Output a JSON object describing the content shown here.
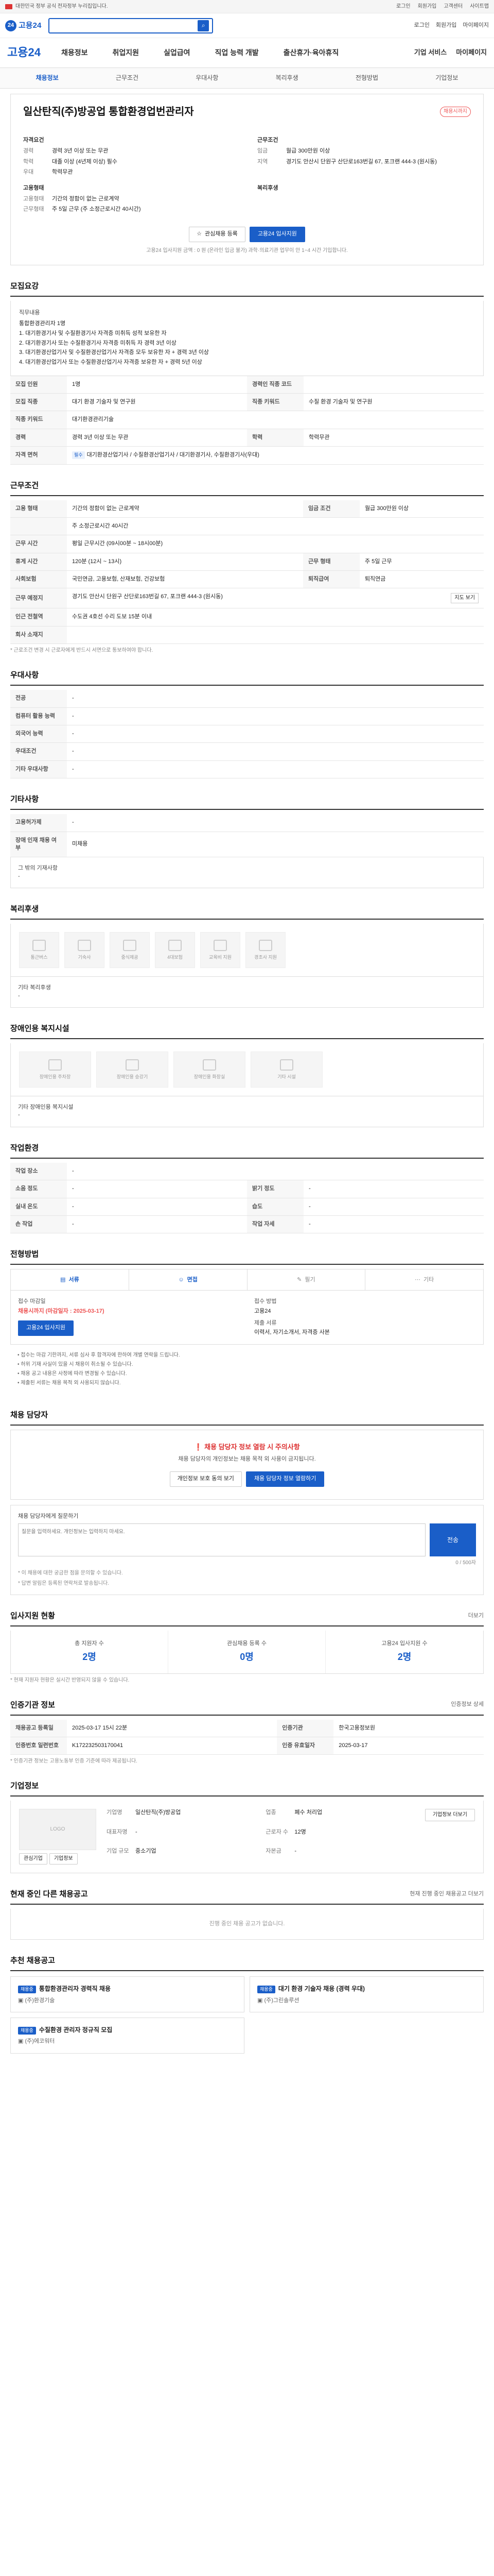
{
  "topbar": {
    "site_name": "대한민국 정부 공식 전자정부 누리집입니다.",
    "links": [
      "로그인",
      "회원가입",
      "고객센터",
      "사이트맵"
    ]
  },
  "header": {
    "logo": "고용24",
    "search_placeholder": "",
    "links": [
      "로그인",
      "회원가입",
      "마이페이지"
    ]
  },
  "nav": {
    "brand": "고용24",
    "items": [
      "채용정보",
      "취업지원",
      "실업급여",
      "직업 능력 개발",
      "출산휴가·육아휴직"
    ],
    "right": [
      "기업 서비스",
      "마이페이지"
    ]
  },
  "subnav": {
    "items": [
      "채용정보",
      "근무조건",
      "우대사항",
      "복리후생",
      "전형방법",
      "기업정보"
    ],
    "active": 0
  },
  "job": {
    "title": "일산탄직(주)방공업 통합환경업번관리자",
    "badge": "채용시까지",
    "info_left_title": "자격요건",
    "info_left": [
      {
        "k": "경력",
        "v": "경력 3년 이상 또는 무관"
      },
      {
        "k": "학력",
        "v": "대졸 이상 (4년제 이상) 필수"
      },
      {
        "k": "우대",
        "v": "학력무관"
      }
    ],
    "info_right_title": "근무조건",
    "info_right": [
      {
        "k": "임금",
        "v": "월급 300만원 이상"
      },
      {
        "k": "지역",
        "v": "경기도 안산시 단원구 산단로163번길 67, 포크랜 444-3 (원시동)"
      }
    ],
    "info_left2_title": "고용형태",
    "info_left2": [
      {
        "k": "고용형태",
        "v": "기간의 정함이 없는 근로계약"
      },
      {
        "k": "근무형태",
        "v": "주 5일 근무 (주 소정근로시간 40시간)"
      }
    ],
    "info_right2_title": "복리후생",
    "btn_interest": "관심채용 등록",
    "btn_apply": "고용24 입사지원",
    "note": "고용24 입사지원 금액 : 0 원 (온라인 입금 불가) 과학·의료기관 업무이 안 1~4 시간 기입합니다."
  },
  "recruit": {
    "title": "모집요강",
    "work_label": "직무내용",
    "work_sub": "통합환경관리자 1명",
    "work_lines": [
      "1. 대기환경기사 및 수질환경기사 자격증 미취득 성적 보유한 자",
      "2. 대기환경기사 또는 수질환경기사 자격증 미취득 자 경력 3년 이상",
      "3. 대기환경산업기사 및 수질환경산업기사 자격증 모두 보유한 자 + 경력 3년 이상",
      "4. 대기환경산업기사 또는 수질환경산업기사 자격증 보유한 자 + 경력 5년 이상"
    ],
    "rows": [
      {
        "k": "모집 인원",
        "v": "1명",
        "k2": "경력인 직종 코드",
        "v2": ""
      },
      {
        "k": "모집 직종",
        "v": "대기 환경 기술자 및 연구원",
        "k2": "직종 키워드",
        "v2": "수질 환경 기술자 및 연구원"
      },
      {
        "k": "직종 키워드",
        "v": "대기환경관리기술",
        "k2": "",
        "v2": ""
      },
      {
        "k": "경력",
        "v": "경력 3년 이상 또는 무관",
        "k2": "학력",
        "v2": "학력무관"
      },
      {
        "k": "자격 면허",
        "v": "대기환경산업기사 / 수질환경산업기사 / 대기환경기사, 수질환경기사(우대)",
        "k2": "",
        "v2": ""
      }
    ]
  },
  "conditions": {
    "title": "근무조건",
    "rows": [
      {
        "k": "고용 형태",
        "v": "기간의 정함이 없는 근로계약",
        "k2": "임금 조건",
        "v2": "월급 300만원 이상"
      },
      {
        "k": "",
        "v": "주 소정근로시간 40시간",
        "k2": "",
        "v2": ""
      },
      {
        "k": "근무 시간",
        "v": "평일 근무시간 (09시00분 ~ 18시00분)",
        "k2": "",
        "v2": ""
      },
      {
        "k": "휴게 시간",
        "v": "120분 (12시 ~ 13시)",
        "k2": "근무 형태",
        "v2": "주 5일 근무"
      },
      {
        "k": "사회보험",
        "v": "국민연금, 고용보험, 산재보험, 건강보험",
        "k2": "퇴직급여",
        "v2": "퇴직연금"
      },
      {
        "k": "근무 예정지",
        "v": "경기도 안산시 단원구 산단로163번길 67, 포크랜 444-3 (원시동)",
        "k2": "",
        "v2": ""
      },
      {
        "k": "인근 전철역",
        "v": "수도권 4호선 수리 도보 15분 이내",
        "k2": "",
        "v2": ""
      },
      {
        "k": "회사 소재지",
        "v": "",
        "k2": "",
        "v2": ""
      }
    ],
    "map_btn": "지도 보기",
    "note": "* 근로조건 변경 시 근로자에게 반드시 서면으로 통보하여야 합니다."
  },
  "preference": {
    "title": "우대사항",
    "rows": [
      {
        "k": "전공",
        "v": "-"
      },
      {
        "k": "컴퓨터 활용 능력",
        "v": "-"
      },
      {
        "k": "외국어 능력",
        "v": "-"
      },
      {
        "k": "우대조건",
        "v": "-"
      },
      {
        "k": "기타 우대사항",
        "v": "-"
      }
    ]
  },
  "other": {
    "title": "기타사항",
    "rows": [
      {
        "k": "고용허가제",
        "v": "-"
      },
      {
        "k": "장애 인재 채용 여부",
        "v": "미채용"
      }
    ],
    "extra_label": "그 밖의 기재사항",
    "extra_value": "-"
  },
  "welfare": {
    "title": "복리후생",
    "icons": [
      "통근버스",
      "기숙사",
      "중식제공",
      "4대보험",
      "교육비 지원",
      "경조사 지원"
    ],
    "sub_label": "기타 복리후생",
    "sub_value": "-"
  },
  "disability": {
    "title": "장애인용 복지시설",
    "icons": [
      "장애인용 주차장",
      "장애인용 승강기",
      "장애인용 화장실",
      "기타 시설"
    ],
    "sub_label": "기타 장애인용 복지시설",
    "sub_value": "-"
  },
  "workenv": {
    "title": "작업환경",
    "rows": [
      {
        "k": "작업 장소",
        "v": "-",
        "k2": "",
        "v2": ""
      },
      {
        "k": "소음 정도",
        "v": "-",
        "k2": "밝기 정도",
        "v2": "-"
      },
      {
        "k": "실내 온도",
        "v": "-",
        "k2": "습도",
        "v2": "-"
      },
      {
        "k": "손 작업",
        "v": "-",
        "k2": "작업 자세",
        "v2": "-"
      }
    ]
  },
  "process": {
    "title": "전형방법",
    "steps": [
      "서류",
      "면접",
      "필기",
      "기타"
    ],
    "deadline_label": "접수 마감일",
    "deadline_value": "채용시까지 (마감일자 : 2025-03-17)",
    "method_label": "접수 방법",
    "method_value": "고용24",
    "doc_label": "제출 서류",
    "doc_value": "이력서, 자기소개서, 자격증 사본",
    "apply_btn": "고용24 입사지원",
    "bullets": [
      "• 접수는 마감 기한까지, 서류 심사 후 합격자에 한하여 개별 연락을 드립니다.",
      "• 허위 기재 사실이 있을 시 채용이 취소될 수 있습니다.",
      "• 채용 공고 내용은 사정에 따라 변경될 수 있습니다.",
      "• 제출된 서류는 채용 목적 외 사용되지 않습니다."
    ]
  },
  "contact": {
    "title": "채용 담당자",
    "warn_title": "채용 담당자 정보 열람 시 주의사항",
    "warn_desc": "채용 담당자의 개인정보는 채용 목적 외 사용이 금지됩니다.",
    "btn_left": "개인정보 보호 동의 보기",
    "btn_right": "채용 담당자 정보 열람하기",
    "qna_title": "채용 담당자에게 질문하기",
    "qna_placeholder": "질문을 입력하세요. 개인정보는 입력하지 마세요.",
    "qna_count": "0 / 500자",
    "qna_send": "전송",
    "notes": [
      "* 이 채용에 대한 궁금한 점을 문의할 수 있습니다.",
      "* 답변 알림은 등록된 연락처로 발송됩니다."
    ]
  },
  "stats": {
    "title": "입사지원 현황",
    "more": "더보기",
    "cells": [
      {
        "label": "총 지원자 수",
        "value": "2명"
      },
      {
        "label": "관심채용 등록 수",
        "value": "0명"
      },
      {
        "label": "고용24 입사지원 수",
        "value": "2명"
      }
    ],
    "note": "* 현재 지원자 현황은 실시간 반영되지 않을 수 있습니다."
  },
  "certinfo": {
    "title": "인증기관 정보",
    "more_btn": "인증정보 상세",
    "rows": [
      {
        "k": "채용공고 등록일",
        "v": "2025-03-17 15시 22분",
        "k2": "인증기관",
        "v2": "한국고용정보원"
      },
      {
        "k": "인증번호 일련번호",
        "v": "K172232503170041",
        "k2": "인증 유효일자",
        "v2": "2025-03-17"
      }
    ],
    "note": "* 인증기관 정보는 고용노동부 인증 기준에 따라 제공됩니다."
  },
  "company": {
    "title": "기업정보",
    "logo_text": "LOGO",
    "btns": [
      "관심기업",
      "기업정보"
    ],
    "detail_btn": "기업정보 더보기",
    "rows": [
      {
        "k": "기업명",
        "v": "일산탄직(주)방공업"
      },
      {
        "k": "업종",
        "v": "폐수 처리업"
      },
      {
        "k": "대표자명",
        "v": "-"
      },
      {
        "k": "근로자 수",
        "v": "12명"
      },
      {
        "k": "기업 규모",
        "v": "중소기업"
      },
      {
        "k": "자본금",
        "v": "-"
      }
    ]
  },
  "other_jobs": {
    "title": "현재 중인 다른 채용공고",
    "more": "현재 진행 중인 채용공고 더보기",
    "empty": "진행 중인 채용 공고가 없습니다."
  },
  "recommend": {
    "title": "추천 채용공고",
    "cards": [
      {
        "badge": "채용중",
        "title": "통합환경관리자 경력직 채용",
        "company": "(주)환경기술"
      },
      {
        "badge": "채용중",
        "title": "대기 환경 기술자 채용 (경력 우대)",
        "company": "(주)그린솔루션"
      },
      {
        "badge": "채용중",
        "title": "수질환경 관리자 정규직 모집",
        "company": "(주)에코워터"
      }
    ]
  }
}
